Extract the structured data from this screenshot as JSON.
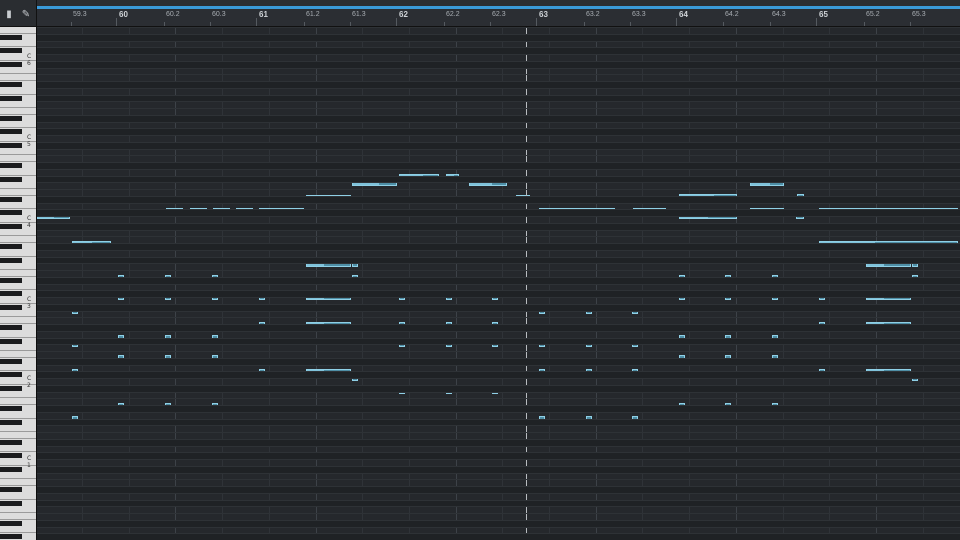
{
  "window": {
    "title": ""
  },
  "toolbar": {
    "tool_1": "pointer-tool-icon",
    "tool_2": "pencil-tool-icon"
  },
  "ruler": {
    "labels": [
      "59.3",
      "60",
      "60.2",
      "60.3",
      "61",
      "61.2",
      "61.3",
      "62",
      "62.2",
      "62.3",
      "63",
      "63.2",
      "63.3",
      "64",
      "64.2",
      "64.3",
      "65",
      "65.2",
      "65.3"
    ],
    "major": [
      "60",
      "61",
      "62",
      "63",
      "64",
      "65"
    ]
  },
  "keyboard": {
    "labels": [
      "C 6",
      "C 5",
      "C 4",
      "C 3",
      "C 2",
      "C 1"
    ]
  },
  "colors": {
    "loop_bar": "#3a9ad9",
    "note_fill": "#4f8fa6",
    "note_border": "#8fd0e6",
    "background": "#1e2125"
  },
  "notes_count_visible": "many"
}
